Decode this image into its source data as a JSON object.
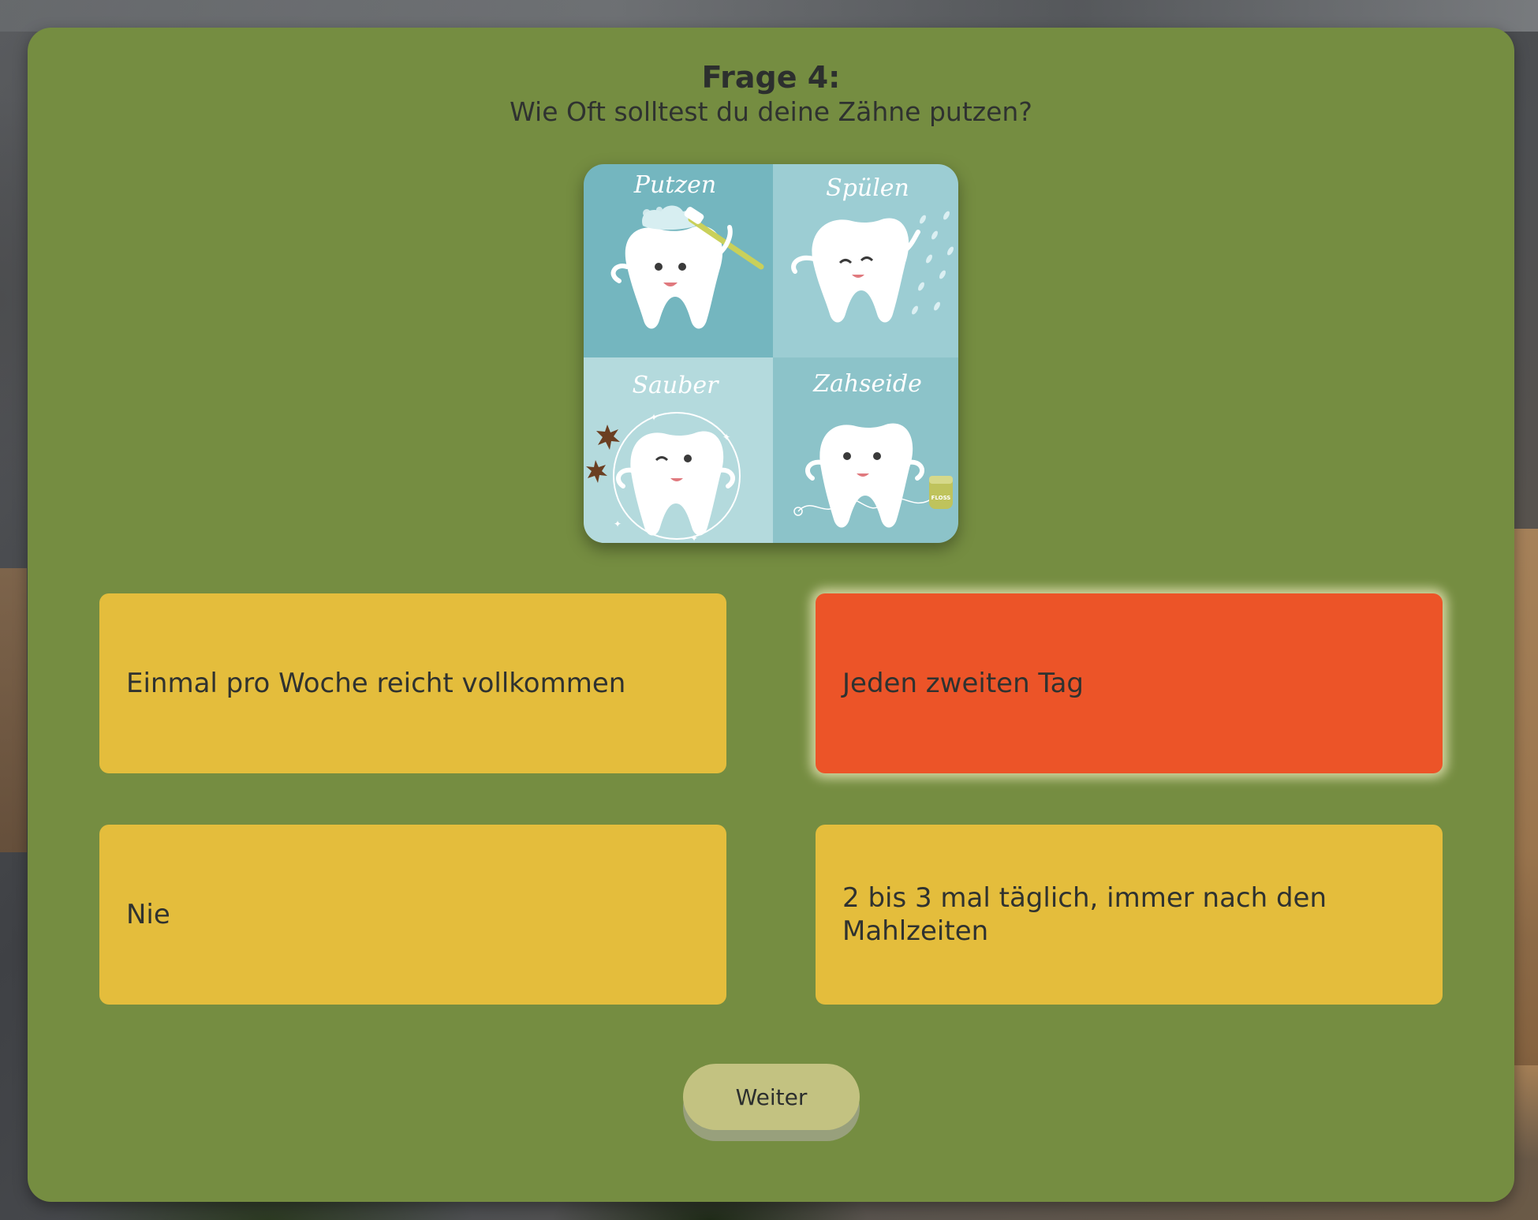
{
  "quiz": {
    "question_title": "Frage 4:",
    "question_text": "Wie Oft solltest du deine Zähne putzen?",
    "illustration": {
      "panels": [
        "Putzen",
        "Spülen",
        "Sauber",
        "Zahseide"
      ],
      "floss_label": "FLOSS"
    },
    "answers": [
      {
        "label": "Einmal pro Woche reicht vollkommen",
        "selected": false
      },
      {
        "label": "Jeden zweiten Tag",
        "selected": true
      },
      {
        "label": "Nie",
        "selected": false
      },
      {
        "label": "2 bis 3 mal täglich, immer nach den Mahlzeiten",
        "selected": false
      }
    ],
    "next_label": "Weiter"
  },
  "colors": {
    "card_background": "#758d41",
    "answer_default": "#e4bd3c",
    "answer_selected": "#ec5428",
    "next_button": "#c3c281",
    "text": "#2f3230"
  },
  "icons": [
    "tooth-brushing-icon",
    "tooth-rinsing-icon",
    "tooth-clean-icon",
    "tooth-floss-icon"
  ]
}
